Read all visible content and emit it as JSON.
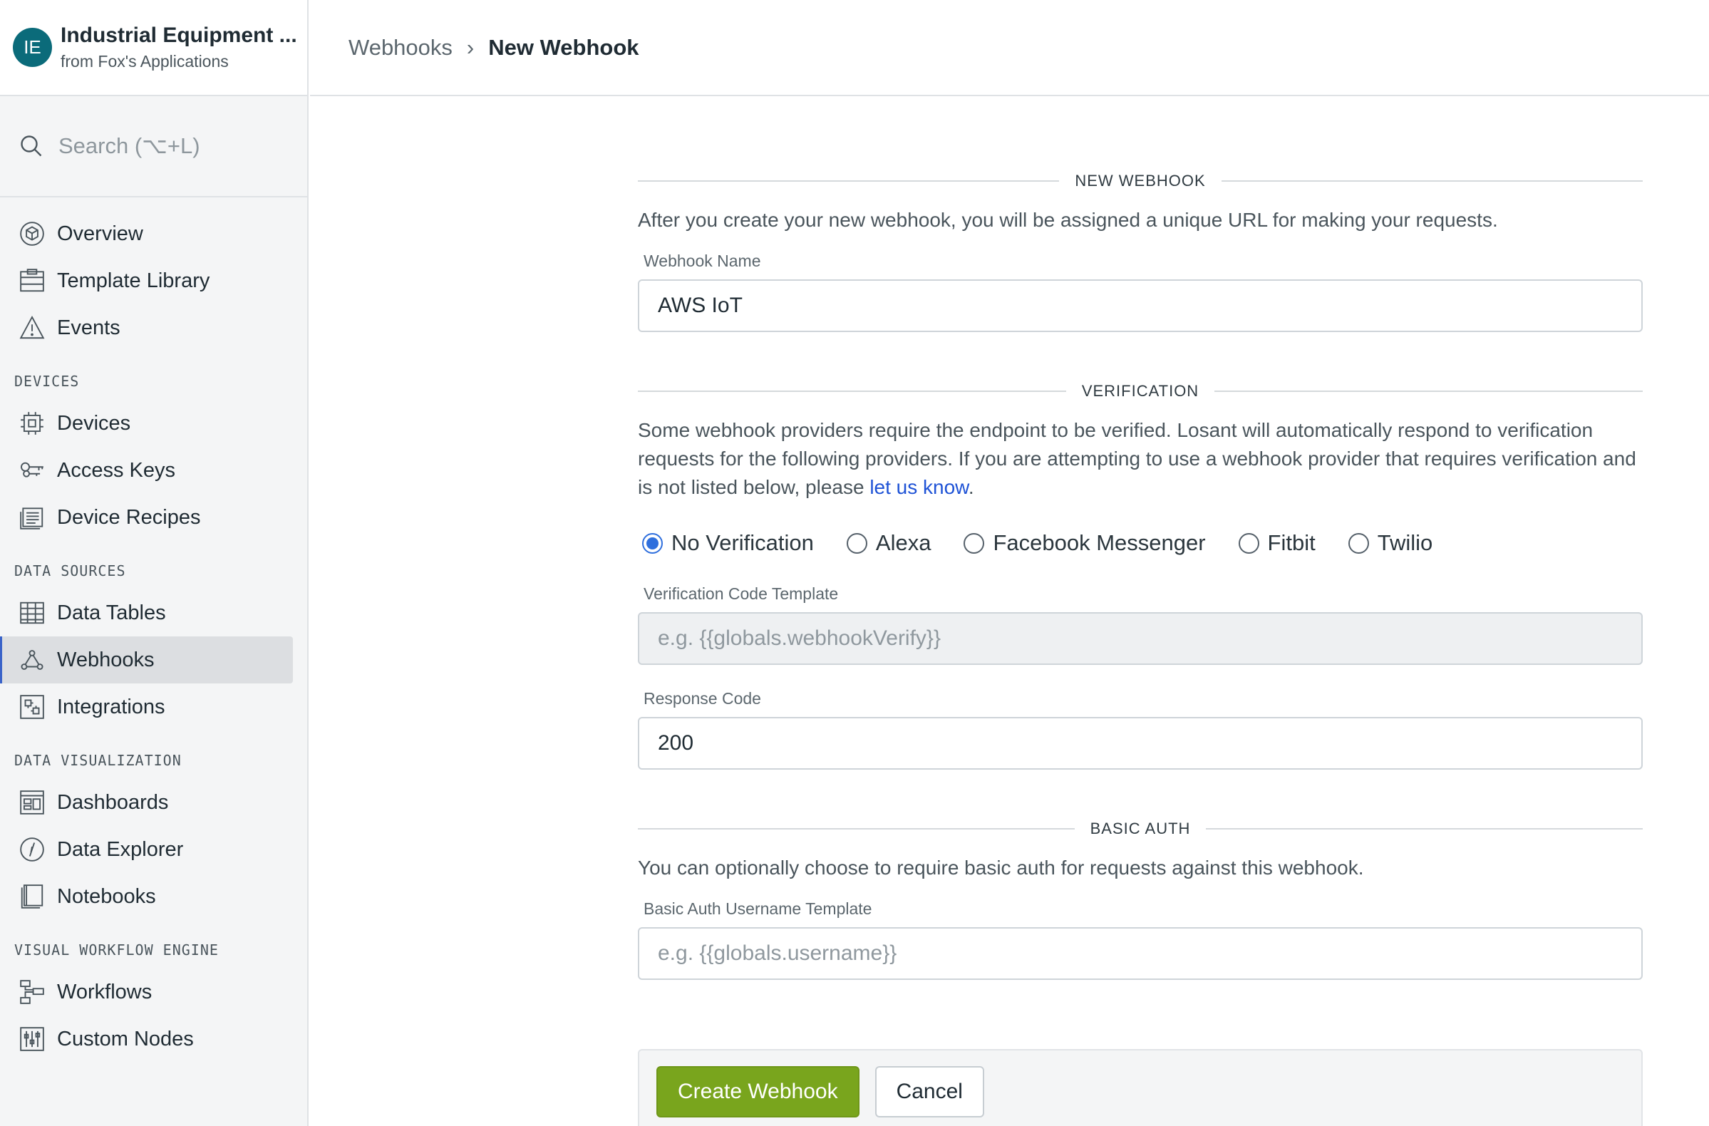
{
  "app": {
    "initials": "IE",
    "name": "Industrial Equipment ...",
    "org": "from Fox's Applications"
  },
  "search": {
    "placeholder": "Search (⌥+L)"
  },
  "sidebar": {
    "top_items": [
      {
        "label": "Overview",
        "icon": "cube-icon"
      },
      {
        "label": "Template Library",
        "icon": "template-library-icon"
      },
      {
        "label": "Events",
        "icon": "warning-triangle-icon"
      }
    ],
    "devices_heading": "DEVICES",
    "devices_items": [
      {
        "label": "Devices",
        "icon": "chip-icon"
      },
      {
        "label": "Access Keys",
        "icon": "keys-icon"
      },
      {
        "label": "Device Recipes",
        "icon": "recipes-icon"
      }
    ],
    "data_sources_heading": "DATA SOURCES",
    "data_sources_items": [
      {
        "label": "Data Tables",
        "icon": "table-icon"
      },
      {
        "label": "Webhooks",
        "icon": "webhook-icon"
      },
      {
        "label": "Integrations",
        "icon": "puzzle-icon"
      }
    ],
    "data_viz_heading": "DATA VISUALIZATION",
    "data_viz_items": [
      {
        "label": "Dashboards",
        "icon": "dashboard-icon"
      },
      {
        "label": "Data Explorer",
        "icon": "compass-icon"
      },
      {
        "label": "Notebooks",
        "icon": "notebook-icon"
      }
    ],
    "workflow_heading": "VISUAL WORKFLOW ENGINE",
    "workflow_items": [
      {
        "label": "Workflows",
        "icon": "workflow-icon"
      },
      {
        "label": "Custom Nodes",
        "icon": "sliders-icon"
      }
    ],
    "active": "Webhooks",
    "active_color": "#3a63c9"
  },
  "breadcrumb": {
    "parent": "Webhooks",
    "separator": "›",
    "current": "New Webhook"
  },
  "form": {
    "new_webhook": {
      "title": "NEW WEBHOOK",
      "description": "After you create your new webhook, you will be assigned a unique URL for making your requests.",
      "name_label": "Webhook Name",
      "name_value": "AWS IoT"
    },
    "verification": {
      "title": "VERIFICATION",
      "description": "Some webhook providers require the endpoint to be verified. Losant will automatically respond to verification requests for the following providers. If you are attempting to use a webhook provider that requires verification and is not listed below, please ",
      "link_text": "let us know",
      "description_end": ".",
      "options": [
        "No Verification",
        "Alexa",
        "Facebook Messenger",
        "Fitbit",
        "Twilio"
      ],
      "selected": "No Verification",
      "code_template_label": "Verification Code Template",
      "code_template_placeholder": "e.g. {{globals.webhookVerify}}",
      "response_code_label": "Response Code",
      "response_code_value": "200"
    },
    "basic_auth": {
      "title": "BASIC AUTH",
      "description": "You can optionally choose to require basic auth for requests against this webhook.",
      "username_label": "Basic Auth Username Template",
      "username_placeholder": "e.g. {{globals.username}}"
    },
    "actions": {
      "create_label": "Create Webhook",
      "cancel_label": "Cancel"
    }
  },
  "colors": {
    "avatar": "#0b6b7a",
    "primary_button": "#79a51d",
    "link": "#1f53d6",
    "radio_selected": "#2f6fdd"
  }
}
